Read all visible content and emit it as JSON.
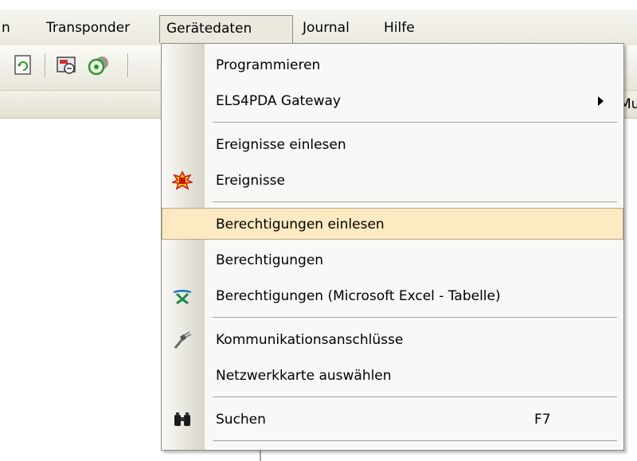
{
  "menubar": {
    "items": [
      {
        "label": "n"
      },
      {
        "label": "Transponder"
      },
      {
        "label": "Gerätedaten"
      },
      {
        "label": "Journal"
      },
      {
        "label": "Hilfe"
      }
    ]
  },
  "strip": {
    "partial_text": "Mu"
  },
  "menu": {
    "items": [
      {
        "label": "Programmieren"
      },
      {
        "label": "ELS4PDA Gateway",
        "submenu": true
      },
      {
        "label": "Ereignisse einlesen"
      },
      {
        "label": "Ereignisse",
        "icon": "events-icon"
      },
      {
        "label": "Berechtigungen einlesen",
        "highlighted": true
      },
      {
        "label": "Berechtigungen"
      },
      {
        "label": "Berechtigungen (Microsoft Excel - Tabelle)",
        "icon": "excel-icon"
      },
      {
        "label": "Kommunikationsanschlüsse",
        "icon": "plug-icon"
      },
      {
        "label": "Netzwerkkarte auswählen"
      },
      {
        "label": "Suchen",
        "shortcut": "F7",
        "icon": "binoculars-icon"
      }
    ]
  },
  "colors": {
    "highlight": "#fde9c2",
    "highlight_border": "#b5a987",
    "menu_bg": "#f8f8f6"
  }
}
